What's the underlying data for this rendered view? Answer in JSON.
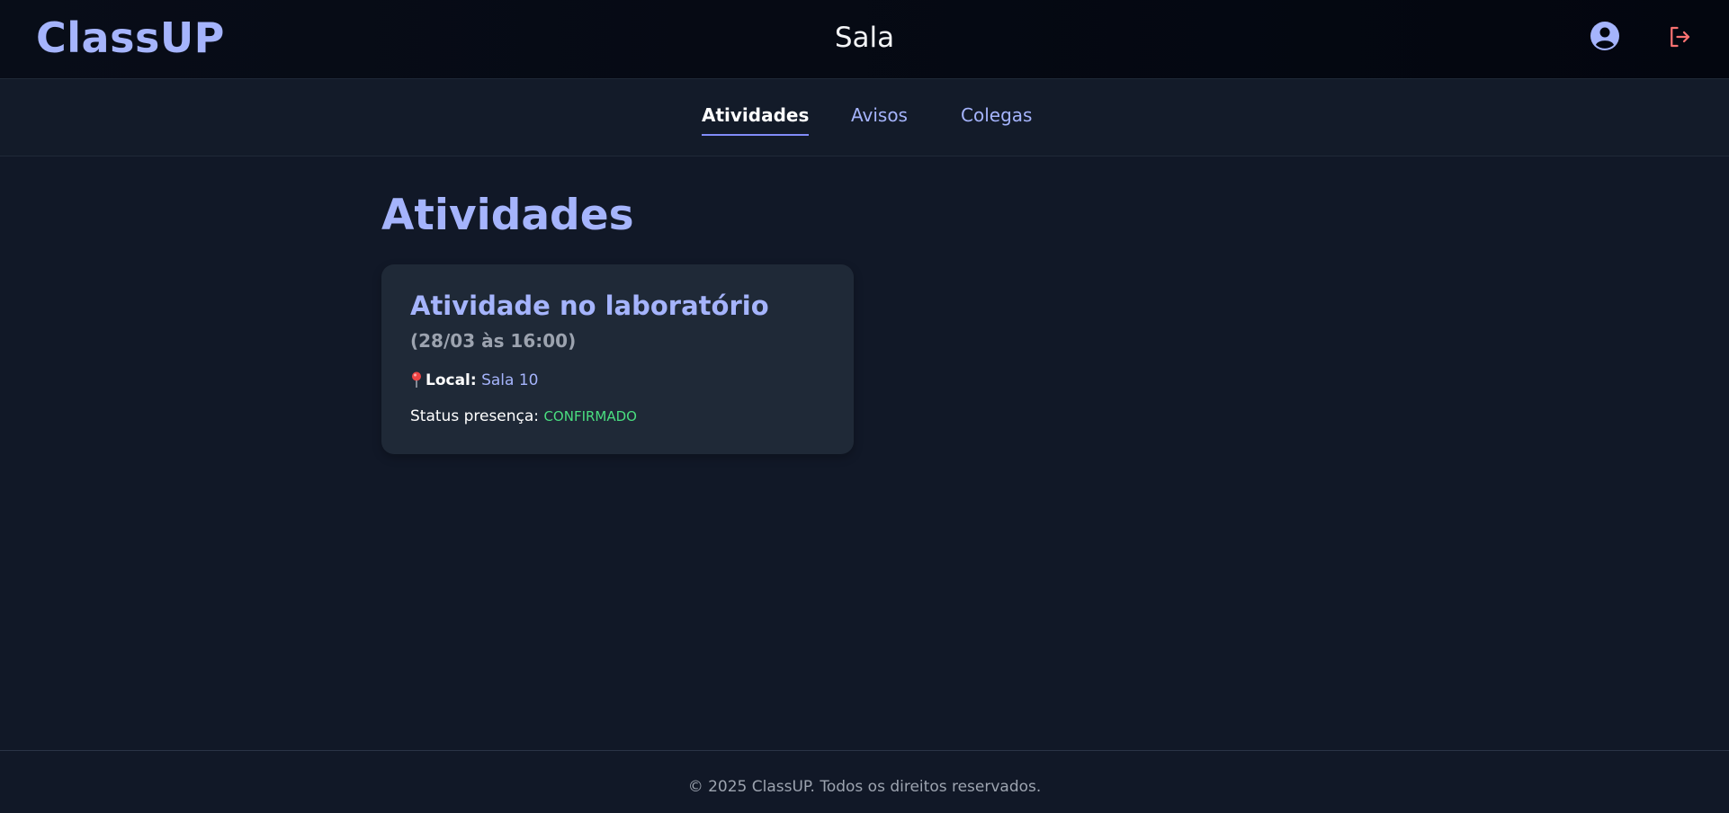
{
  "header": {
    "brand": "ClassUP",
    "title": "Sala",
    "user_icon": "user-circle-icon",
    "logout_icon": "logout-icon",
    "accent_color": "#a5b4fc",
    "logout_color": "#f87171"
  },
  "tabs": [
    {
      "label": "Atividades",
      "active": true
    },
    {
      "label": "Avisos",
      "active": false
    },
    {
      "label": "Colegas",
      "active": false
    }
  ],
  "main": {
    "section_title": "Atividades",
    "activities": [
      {
        "title": "Atividade no laboratório",
        "datetime": "(28/03 às 16:00)",
        "local_icon": "map-pin-icon",
        "local_label": "Local:",
        "local_value": "Sala 10",
        "status_label": "Status presença:",
        "status_value": "CONFIRMADO",
        "status_color": "#4ade80"
      }
    ]
  },
  "footer": {
    "text": "© 2025 ClassUP. Todos os direitos reservados."
  }
}
